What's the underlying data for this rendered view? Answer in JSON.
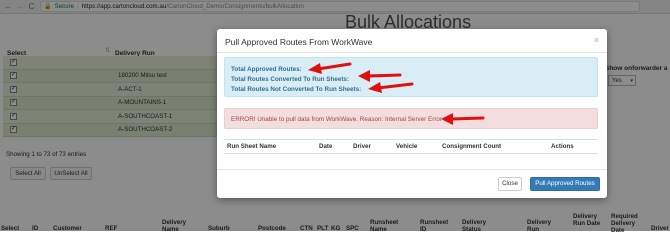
{
  "browser": {
    "back": "←",
    "forward": "→",
    "reload": "C",
    "secure_label": "Secure",
    "url_domain": "https://app.cartoncloud.com.au",
    "url_path": "/CartonCloud_Demo/Consignments/bulkAllocation"
  },
  "page": {
    "title": "Bulk Allocations",
    "col_select": "Select",
    "col_delivery_run": "Delivery Run",
    "rows": [
      "",
      "180200 Mitsu test",
      "A-ACT-1",
      "A-MOUNTAINS-1",
      "A-SOUTHCOAST-1",
      "A-SOUTHCOAST-2"
    ],
    "entries": "Showing 1 to 73 of 73 entries",
    "select_all": "Select All",
    "unselect_all": "UnSelect All",
    "show_onforwarder": "Show onforwarder a",
    "yes_value": "Yes",
    "bottom_headers": [
      "Select",
      "ID",
      "Customer",
      "REF",
      "Delivery Name",
      "Suburb",
      "Postcode",
      "CTN",
      "PLT",
      "KG",
      "SPC",
      "Runsheet Name",
      "Runsheet ID",
      "Delivery Status",
      "Delivery Run",
      "Delivery Run Date",
      "Required Delivery Date",
      "Driver"
    ]
  },
  "modal": {
    "title": "Pull Approved Routes From WorkWave",
    "close_symbol": "×",
    "total_approved": "Total Approved Routes:",
    "total_converted": "Total Routes Converted To Run Sheets:",
    "total_not_converted": "Total Routes Not Converted To Run Sheets:",
    "error": "ERROR! Unable to pull data from WorkWave. Reason: Internal Server Error",
    "table_headers": [
      "Run Sheet Name",
      "Date",
      "Driver",
      "Vehicle",
      "Consignment Count",
      "Actions"
    ],
    "close_button": "Close",
    "pull_button": "Pull Approved Routes"
  },
  "colors": {
    "arrow": "#e01010",
    "primary": "#337ab7",
    "info_bg": "#d9edf7",
    "error_bg": "#f2dede",
    "row_bg": "#dde9cc"
  }
}
